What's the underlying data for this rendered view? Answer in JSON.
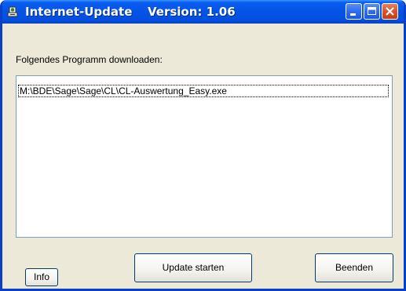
{
  "window": {
    "title": "Internet-Update",
    "version": "Version: 1.06"
  },
  "dialog": {
    "prompt_label": "Folgendes Programm downloaden:",
    "files": [
      "M:\\BDE\\Sage\\Sage\\CL\\CL-Auswertung_Easy.exe"
    ]
  },
  "buttons": {
    "info": "Info",
    "update": "Update starten",
    "exit": "Beenden"
  },
  "icons": {
    "app": "update-app-icon",
    "minimize": "minimize-icon",
    "maximize": "maximize-icon",
    "close": "close-icon"
  },
  "colors": {
    "titlebar": "#0453e6",
    "close_button": "#d9532a",
    "window_face": "#ece9d8"
  }
}
